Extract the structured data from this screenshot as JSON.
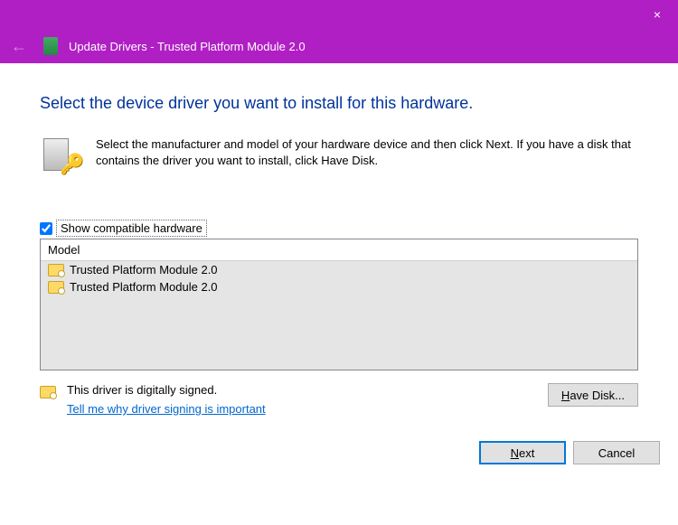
{
  "titlebar": {
    "close_icon": "×"
  },
  "breadcrumb": {
    "back_icon": "←",
    "title": "Update Drivers - Trusted Platform Module 2.0"
  },
  "heading": "Select the device driver you want to install for this hardware.",
  "instruction": "Select the manufacturer and model of your hardware device and then click Next. If you have a disk that contains the driver you want to install, click Have Disk.",
  "compat_checkbox": {
    "label": "Show compatible hardware",
    "checked": true
  },
  "model_table": {
    "header": "Model",
    "rows": [
      "Trusted Platform Module 2.0",
      "Trusted Platform Module 2.0"
    ]
  },
  "signed": {
    "text": "This driver is digitally signed.",
    "link": "Tell me why driver signing is important"
  },
  "buttons": {
    "have_disk_pre": "",
    "have_disk_key": "H",
    "have_disk_post": "ave Disk...",
    "next_pre": "",
    "next_key": "N",
    "next_post": "ext",
    "cancel": "Cancel"
  }
}
